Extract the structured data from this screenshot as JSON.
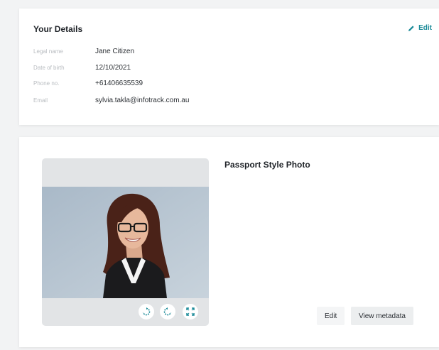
{
  "details": {
    "title": "Your Details",
    "edit_label": "Edit",
    "fields": [
      {
        "label": "Legal name",
        "value": "Jane Citizen"
      },
      {
        "label": "Date of birth",
        "value": "12/10/2021"
      },
      {
        "label": "Phone no.",
        "value": "+61406635539"
      },
      {
        "label": "Email",
        "value": "sylvia.takla@infotrack.com.au"
      }
    ]
  },
  "photo": {
    "title": "Passport Style Photo",
    "edit_label": "Edit",
    "view_metadata_label": "View metadata",
    "tools": [
      "rotate-right-icon",
      "rotate-left-icon",
      "expand-icon"
    ]
  },
  "colors": {
    "accent": "#1a8a98",
    "page_bg": "#f2f3f4",
    "card_bg": "#ffffff"
  }
}
